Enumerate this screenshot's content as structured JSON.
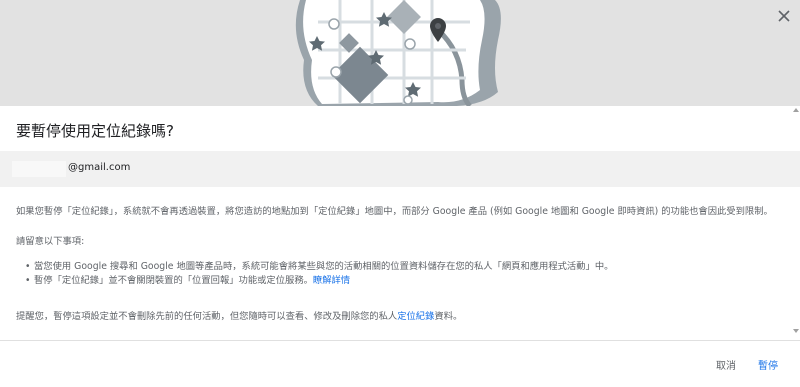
{
  "dialog": {
    "title": "要暫停使用定位紀錄嗎?",
    "account_email": "@gmail.com",
    "paragraph1": "如果您暫停「定位紀錄」，系統就不會再透過裝置，將您造訪的地點加到「定位紀錄」地圖中，而部分 Google 產品 (例如 Google 地圖和 Google 即時資訊) 的功能也會因此受到限制。",
    "notice_title": "請留意以下事項:",
    "bullet1": "當您使用 Google 搜尋和 Google 地圖等產品時，系統可能會將某些與您的活動相關的位置資料儲存在您的私人「網頁和應用程式活動」中。",
    "bullet2_text": "暫停「定位紀錄」並不會關閉裝置的「位置回報」功能或定位服務。",
    "bullet2_link": "瞭解詳情",
    "reminder_text": "提醒您，暫停這項設定並不會刪除先前的任何活動，但您隨時可以查看、修改及刪除您的私人",
    "reminder_link": "定位紀錄",
    "reminder_suffix": "資料。",
    "cancel_label": "取消",
    "pause_label": "暫停"
  },
  "icons": {
    "close": "close-icon",
    "map": "map-illustration",
    "pin": "location-pin-icon",
    "star": "star-icon"
  },
  "colors": {
    "link": "#1a73e8",
    "hero_bg": "#e2e2e2",
    "map_land": "#ffffff",
    "map_edge": "#9aa4ab",
    "map_block": "#7c8790"
  }
}
